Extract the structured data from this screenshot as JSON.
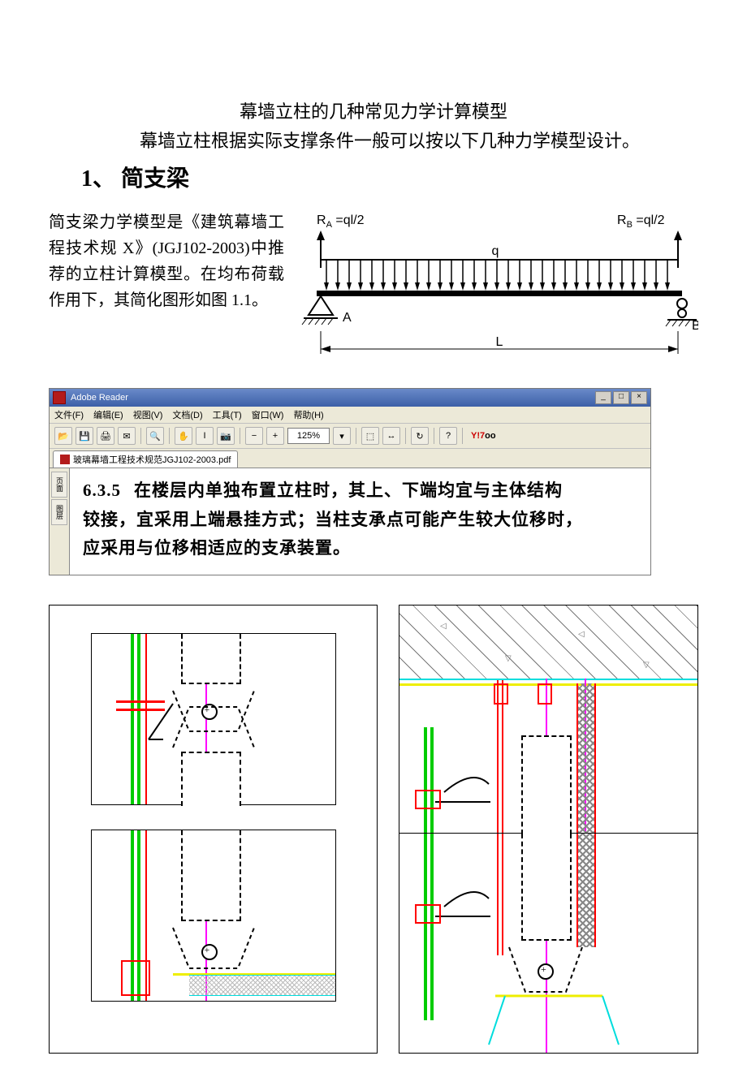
{
  "title": "幕墙立柱的几种常见力学计算模型",
  "subtitle": "幕墙立柱根据实际支撑条件一般可以按以下几种力学模型设计。",
  "heading": "1、 简支梁",
  "paragraph": "简支梁力学模型是《建筑幕墙工程技术规 X》(JGJ102-2003)中推荐的立柱计算模型。在均布荷载作用下，其简化图形如图 1.1。",
  "beam": {
    "ra": "R",
    "ra_sub": "A",
    "ra_expr": " =ql/2",
    "rb": "R",
    "rb_sub": "B",
    "rb_expr": " =ql/2",
    "q": "q",
    "A": "A",
    "B": "B",
    "L": "L"
  },
  "reader": {
    "app_title": "Adobe Reader",
    "menus": {
      "file": "文件(F)",
      "edit": "编辑(E)",
      "view": "视图(V)",
      "document": "文档(D)",
      "tools": "工具(T)",
      "window": "窗口(W)",
      "help": "帮助(H)"
    },
    "zoom": "125%",
    "yahoo": "Y!",
    "tab_title": "玻璃幕墙工程技术规范JGJ102-2003.pdf",
    "sidebar": {
      "pages": "页面",
      "layers": "图层"
    },
    "section_number": "6.3.5",
    "text_line1": "在楼层内单独布置立柱时，其上、下端均宜与主体结构",
    "text_line2": "铰接，宜采用上端悬挂方式；当柱支承点可能产生较大位移时，",
    "text_line3": "应采用与位移相适应的支承装置。"
  }
}
